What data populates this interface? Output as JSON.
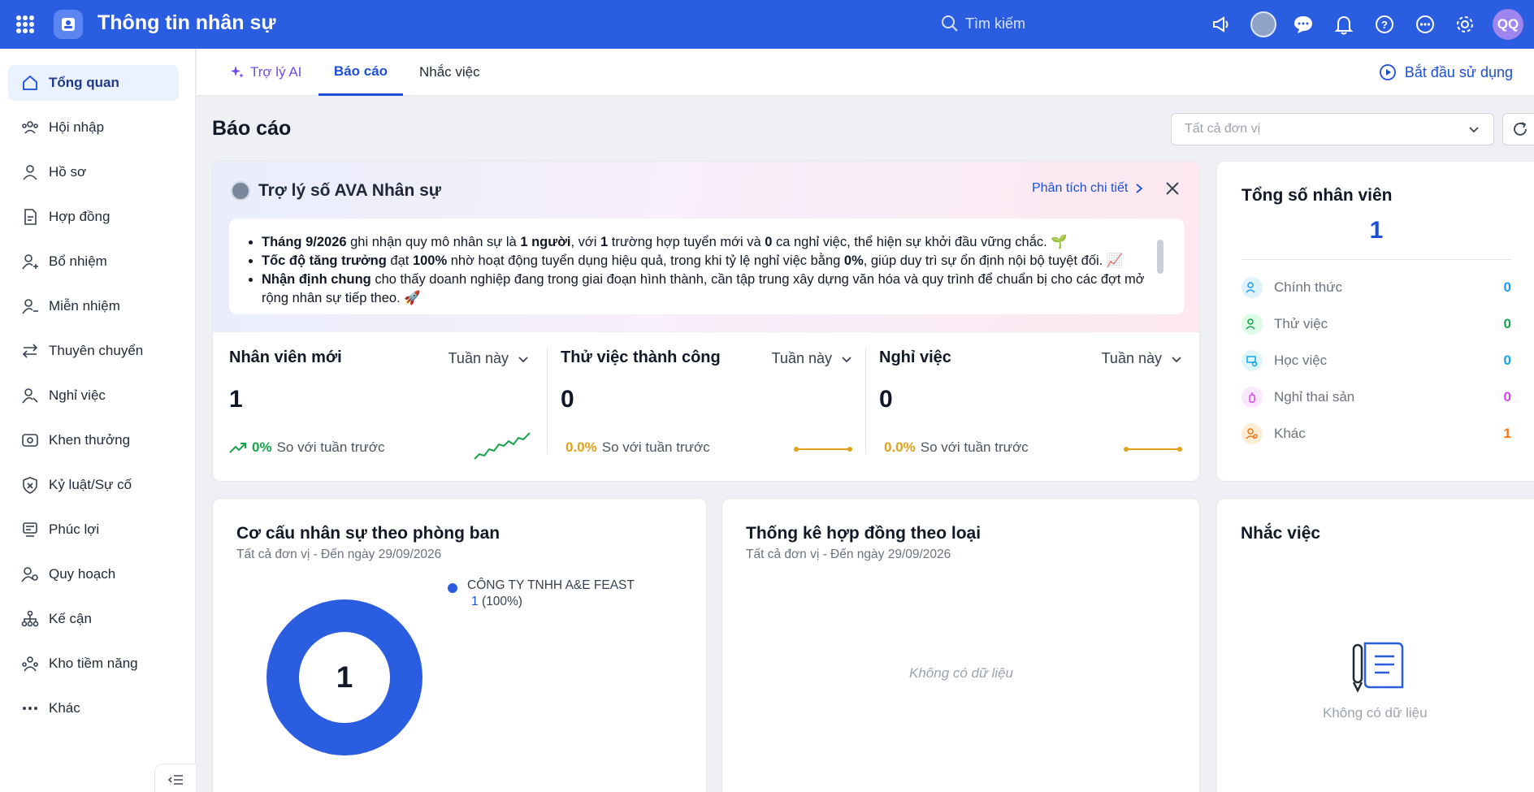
{
  "header": {
    "app_title": "Thông tin nhân sự",
    "search_placeholder": "Tìm kiếm",
    "user_initials": "QQ",
    "accent_color": "#2b5de0"
  },
  "sidebar": {
    "items": [
      {
        "label": "Tổng quan",
        "icon": "home-icon",
        "active": true
      },
      {
        "label": "Hội nhập",
        "icon": "users-icon"
      },
      {
        "label": "Hồ sơ",
        "icon": "user-icon"
      },
      {
        "label": "Hợp đồng",
        "icon": "document-icon"
      },
      {
        "label": "Bổ nhiệm",
        "icon": "user-add-icon"
      },
      {
        "label": "Miễn nhiệm",
        "icon": "user-remove-icon"
      },
      {
        "label": "Thuyên chuyển",
        "icon": "transfer-icon"
      },
      {
        "label": "Nghỉ việc",
        "icon": "user-off-icon"
      },
      {
        "label": "Khen thưởng",
        "icon": "award-icon"
      },
      {
        "label": "Kỷ luật/Sự cố",
        "icon": "shield-x-icon"
      },
      {
        "label": "Phúc lợi",
        "icon": "benefit-icon"
      },
      {
        "label": "Quy hoạch",
        "icon": "planning-icon"
      },
      {
        "label": "Kế cận",
        "icon": "hierarchy-icon"
      },
      {
        "label": "Kho tiềm năng",
        "icon": "talent-pool-icon"
      },
      {
        "label": "Khác",
        "icon": "more-icon"
      }
    ]
  },
  "tabs": {
    "ai": "Trợ lý AI",
    "report": "Báo cáo",
    "reminder": "Nhắc việc",
    "start": "Bắt đầu sử dụng"
  },
  "page": {
    "title": "Báo cáo",
    "unit_placeholder": "Tất cả đơn vị"
  },
  "ai_assistant": {
    "title": "Trợ lý số AVA Nhân sự",
    "detail_link": "Phân tích chi tiết",
    "bullets": [
      {
        "bold": "Tháng 9/2026",
        "text": " ghi nhận quy mô nhân sự là ",
        "b2": "1 người",
        "t2": ", với ",
        "b3": "1",
        "t3": " trường hợp tuyển mới và ",
        "b4": "0",
        "t4": " ca nghỉ việc, thể hiện sự khởi đầu vững chắc. 🌱"
      },
      {
        "bold": "Tốc độ tăng trưởng",
        "text": " đạt ",
        "b2": "100%",
        "t2": " nhờ hoạt động tuyển dụng hiệu quả, trong khi tỷ lệ nghỉ việc bằng ",
        "b3": "0%",
        "t3": ", giúp duy trì sự ổn định nội bộ tuyệt đối. 📈",
        "b4": "",
        "t4": ""
      },
      {
        "bold": "Nhận định chung",
        "text": " cho thấy doanh nghiệp đang trong giai đoạn hình thành, cần tập trung xây dựng văn hóa và quy trình để chuẩn bị cho các đợt mở rộng nhân sự tiếp theo. 🚀",
        "b2": "",
        "t2": "",
        "b3": "",
        "t3": "",
        "b4": "",
        "t4": ""
      }
    ]
  },
  "stats": [
    {
      "title": "Nhân viên mới",
      "period": "Tuần này",
      "value": "1",
      "pct": "0%",
      "compare": "So với tuần trước",
      "trend": "up"
    },
    {
      "title": "Thử việc thành công",
      "period": "Tuần này",
      "value": "0",
      "pct": "0.0%",
      "compare": "So với tuần trước",
      "trend": "flat"
    },
    {
      "title": "Nghỉ việc",
      "period": "Tuần này",
      "value": "0",
      "pct": "0.0%",
      "compare": "So với tuần trước",
      "trend": "flat"
    }
  ],
  "total": {
    "title": "Tổng số nhân viên",
    "value": "1",
    "rows": [
      {
        "label": "Chính thức",
        "value": "0",
        "color": "#1d9bf0"
      },
      {
        "label": "Thử việc",
        "value": "0",
        "color": "#16a34a"
      },
      {
        "label": "Học việc",
        "value": "0",
        "color": "#0ea5e9"
      },
      {
        "label": "Nghỉ thai sản",
        "value": "0",
        "color": "#d946ef"
      },
      {
        "label": "Khác",
        "value": "1",
        "color": "#f97316"
      }
    ]
  },
  "dept": {
    "title": "Cơ cấu nhân sự theo phòng ban",
    "subtitle": "Tất cả đơn vị  -  Đến ngày 29/09/2026",
    "center": "1",
    "legend_name": "CÔNG TY TNHH A&E FEAST",
    "legend_count": "1",
    "legend_pct": "(100%)"
  },
  "chart_data": {
    "type": "pie",
    "categories": [
      "CÔNG TY TNHH A&E FEAST"
    ],
    "values": [
      1
    ],
    "percent": [
      100
    ],
    "title": "Cơ cấu nhân sự theo phòng ban"
  },
  "contract": {
    "title": "Thống kê hợp đồng theo loại",
    "subtitle": "Tất cả đơn vị  -  Đến ngày 29/09/2026",
    "empty": "Không có dữ liệu"
  },
  "tasks": {
    "title": "Nhắc việc",
    "empty": "Không có dữ liệu"
  }
}
